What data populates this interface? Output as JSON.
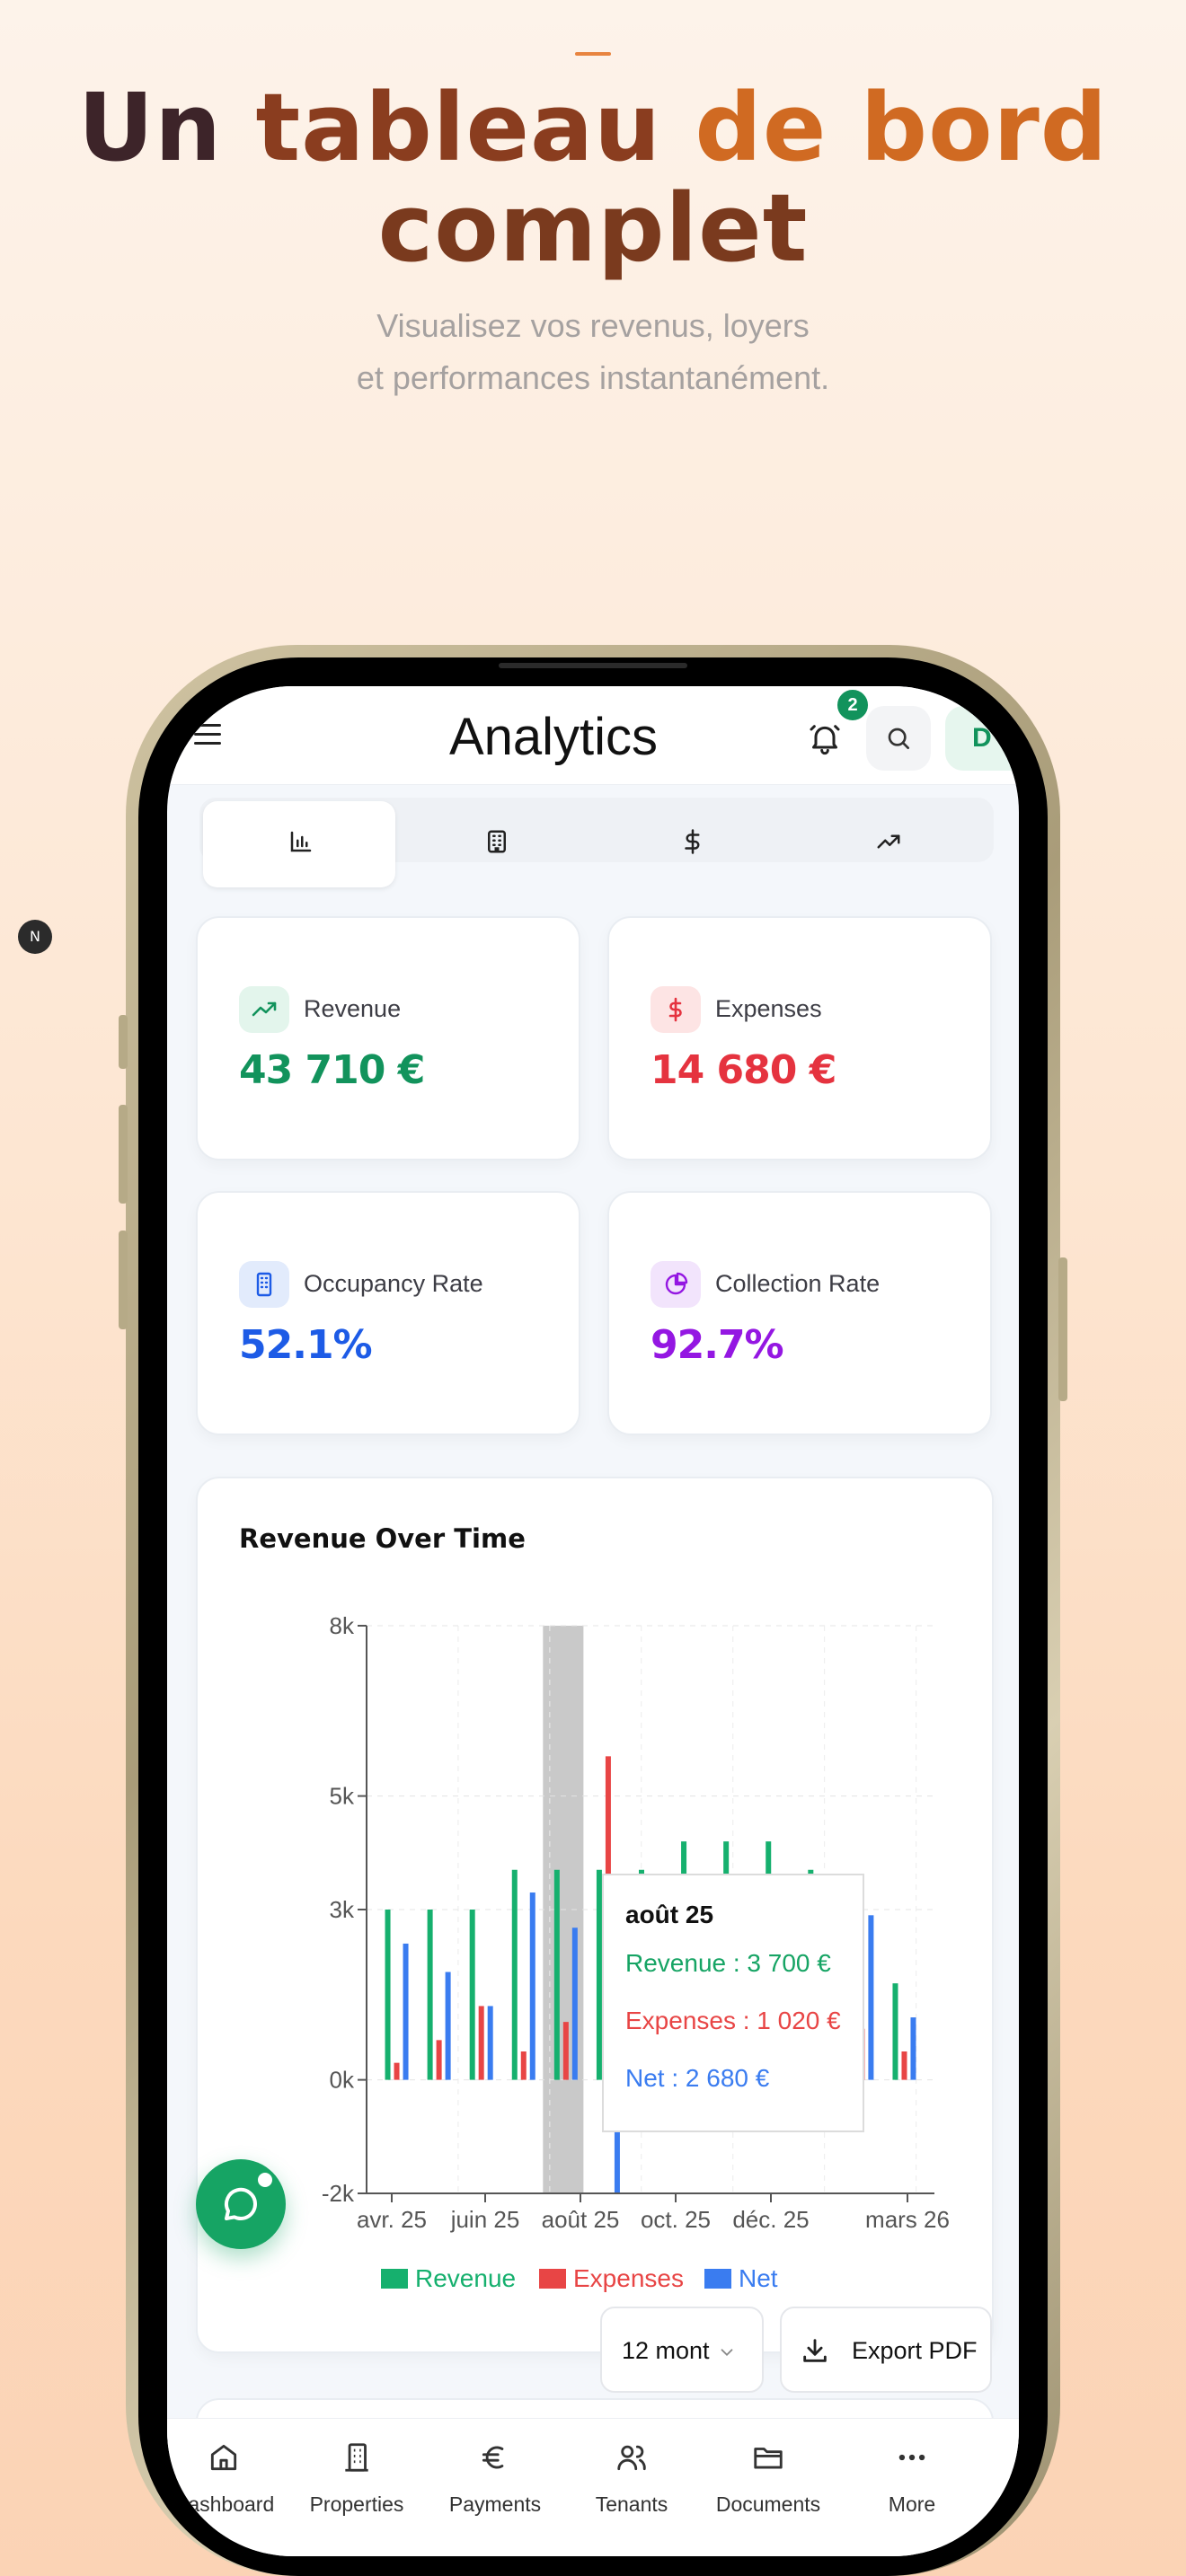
{
  "hero": {
    "title_line1_words": [
      "Un",
      "tableau",
      "de",
      "bord"
    ],
    "title_line2": "complet",
    "subtitle_line1": "Visualisez vos revenus, loyers",
    "subtitle_line2": "et performances instantanément."
  },
  "side_badge": "N",
  "header": {
    "title": "Analytics",
    "notification_count": "2",
    "avatar_initial": "D"
  },
  "tabs": [
    {
      "icon": "bar-chart-icon",
      "active": true
    },
    {
      "icon": "building-icon",
      "active": false
    },
    {
      "icon": "dollar-icon",
      "active": false
    },
    {
      "icon": "trend-up-icon",
      "active": false
    }
  ],
  "stats": {
    "revenue": {
      "label": "Revenue",
      "value": "43 710 €",
      "color": "#12935c"
    },
    "expenses": {
      "label": "Expenses",
      "value": "14 680 €",
      "color": "#e5333f"
    },
    "occupancy": {
      "label": "Occupancy Rate",
      "value": "52.1%",
      "color": "#1d5be6"
    },
    "collection": {
      "label": "Collection Rate",
      "value": "92.7%",
      "color": "#9417e2"
    }
  },
  "chart_title": "Revenue Over Time",
  "chart_data": {
    "type": "bar",
    "x_tick_labels": [
      "avr. 25",
      "juin 25",
      "août 25",
      "oct. 25",
      "déc. 25",
      "mars 26"
    ],
    "y_ticks": [
      "8k",
      "5k",
      "3k",
      "0k",
      "-2k"
    ],
    "ylim": [
      -2000,
      8000
    ],
    "grid": true,
    "legend_position": "bottom",
    "series": [
      {
        "name": "Revenue",
        "color": "#16b06e",
        "values": [
          3000,
          3000,
          3000,
          3700,
          3700,
          3700,
          3700,
          4200,
          4200,
          4200,
          3700,
          null,
          1700
        ]
      },
      {
        "name": "Expenses",
        "color": "#e84545",
        "values": [
          300,
          700,
          1300,
          500,
          1020,
          5700,
          800,
          700,
          900,
          1000,
          1100,
          900,
          500
        ]
      },
      {
        "name": "Net",
        "color": "#3a7cf0",
        "values": [
          2400,
          1900,
          1300,
          3300,
          2680,
          -2000,
          3000,
          3600,
          3000,
          3300,
          3300,
          2900,
          1100
        ]
      }
    ],
    "highlight_index": 4
  },
  "tooltip": {
    "title": "août 25",
    "revenue": "Revenue : 3 700 €",
    "expenses": "Expenses : 1 020 €",
    "net": "Net : 2 680 €"
  },
  "legend": [
    "Revenue",
    "Expenses",
    "Net"
  ],
  "controls": {
    "period": "12 mont",
    "export": "Export PDF"
  },
  "nav": [
    {
      "label": "Dashboard",
      "icon": "home-icon"
    },
    {
      "label": "Properties",
      "icon": "building-icon"
    },
    {
      "label": "Payments",
      "icon": "euro-icon"
    },
    {
      "label": "Tenants",
      "icon": "users-icon"
    },
    {
      "label": "Documents",
      "icon": "folder-icon"
    },
    {
      "label": "More",
      "icon": "more-icon"
    }
  ]
}
